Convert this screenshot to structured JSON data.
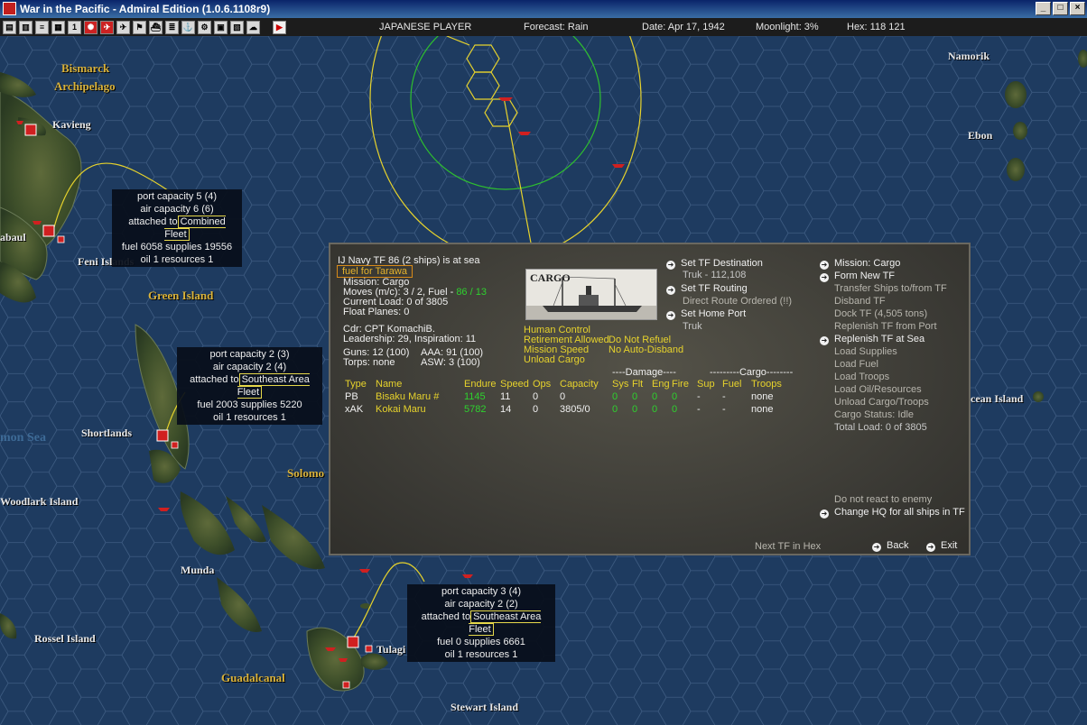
{
  "window": {
    "title": "War in the Pacific - Admiral Edition (1.0.6.1108r9)"
  },
  "toolbar": {
    "buttons": [
      "book-icon",
      "book-icon",
      "report-icon",
      "report-icon",
      "info-icon",
      "japan-flag-icon",
      "aircraft-icon",
      "aircraft-icon",
      "flag-icon",
      "ship-icon",
      "report-icon",
      "ship-icon",
      "gear-icon",
      "save-icon",
      "chart-icon",
      "cloud-icon",
      "play-icon"
    ],
    "side": "JAPANESE PLAYER",
    "forecast": "Forecast: Rain",
    "date": "Date: Apr 17, 1942",
    "moonlight": "Moonlight: 3%",
    "hex": "Hex: 118 121"
  },
  "map": {
    "places": {
      "bismarck": "Bismarck",
      "archipelago": "Archipelago",
      "kavieng": "Kavieng",
      "rabaul": "abaul",
      "feni": "Feni Islands",
      "green": "Green Island",
      "shortlands": "Shortlands",
      "solomon_sea": "mon Sea",
      "solomo": "Solomo",
      "woodlark": "Woodlark Island",
      "munda": "Munda",
      "rossel": "Rossel Island",
      "guadalcanal": "Guadalcanal",
      "tulagi": "Tulagi",
      "stewart": "Stewart Island",
      "namorik": "Namorik",
      "ebon": "Ebon",
      "ocean": "cean Island"
    },
    "bases": [
      {
        "port": "port capacity 5 (4)",
        "air": "air capacity 6 (6)",
        "attached": "attached to",
        "hq": "Combined Fleet",
        "fuel": "fuel 6058  supplies 19556",
        "oil": "oil 1  resources 1"
      },
      {
        "port": "port capacity 2 (3)",
        "air": "air capacity 2 (4)",
        "attached": "attached to",
        "hq": "Southeast Area Fleet",
        "fuel": "fuel 2003  supplies 5220",
        "oil": "oil 1  resources 1"
      },
      {
        "port": "port capacity 3 (4)",
        "air": "air capacity 2 (2)",
        "attached": "attached to",
        "hq": "Southeast Area Fleet",
        "fuel": "fuel 0  supplies 6661",
        "oil": "oil 1  resources 1"
      }
    ]
  },
  "tf": {
    "header": "IJ Navy TF 86 (2 ships) is at sea",
    "name_tag": "fuel for Tarawa",
    "mission": "Mission: Cargo",
    "moves": "Moves (m/c): 3 / 2, Fuel - ",
    "fuel_value": "86 / 13",
    "load": "Current Load: 0 of 3805",
    "float": "Float Planes: 0",
    "cdr": "Cdr: CPT  KomachiB.",
    "leadership": "Leadership: 29, Inspiration: 11",
    "guns": "Guns: 12 (100)",
    "aaa": "AAA: 91 (100)",
    "torps": "Torps: none",
    "asw": "ASW: 3 (100)",
    "image_label": "CARGO",
    "settings": [
      "Human Control",
      "Retirement Allowed",
      "Mission Speed",
      "Unload Cargo"
    ],
    "settings2": [
      "Do Not Refuel",
      "No Auto-Disband"
    ],
    "nav": {
      "set_dest": "Set TF Destination",
      "dest_val": "Truk - 112,108",
      "set_routing": "Set TF Routing",
      "direct": "Direct Route Ordered (!!)",
      "set_home": "Set Home Port",
      "home_val": "Truk"
    },
    "actions": {
      "mission": "Mission: Cargo",
      "form_new": "Form New TF",
      "transfer": "Transfer Ships to/from TF",
      "disband": "Disband TF",
      "dock": "Dock TF (4,505 tons)",
      "replenish_port": "Replenish TF from Port",
      "replenish_sea": "Replenish TF at Sea",
      "load_supplies": "Load Supplies",
      "load_fuel": "Load Fuel",
      "load_troops": "Load Troops",
      "load_oil": "Load Oil/Resources",
      "unload": "Unload Cargo/Troops",
      "cargo_status": "Cargo Status: Idle",
      "total_load": "Total Load: 0 of 3805",
      "no_react": "Do not react to enemy",
      "change_hq": "Change HQ for all ships in TF"
    },
    "table": {
      "group_damage": "----Damage----",
      "group_cargo": "---------Cargo--------",
      "headers": [
        "Type",
        "Name",
        "Endure",
        "Speed",
        "Ops",
        "Capacity",
        "Sys",
        "Flt",
        "Eng",
        "Fire",
        "Sup",
        "Fuel",
        "Troops"
      ],
      "rows": [
        [
          "PB",
          "Bisaku Maru #",
          "1145",
          "11",
          "0",
          "0",
          "0",
          "0",
          "0",
          "0",
          "-",
          "-",
          "none"
        ],
        [
          "xAK",
          "Kokai Maru",
          "5782",
          "14",
          "0",
          "3805/0",
          "0",
          "0",
          "0",
          "0",
          "-",
          "-",
          "none"
        ]
      ]
    },
    "footer": {
      "next": "Next TF in Hex",
      "back": "Back",
      "exit": "Exit"
    }
  }
}
